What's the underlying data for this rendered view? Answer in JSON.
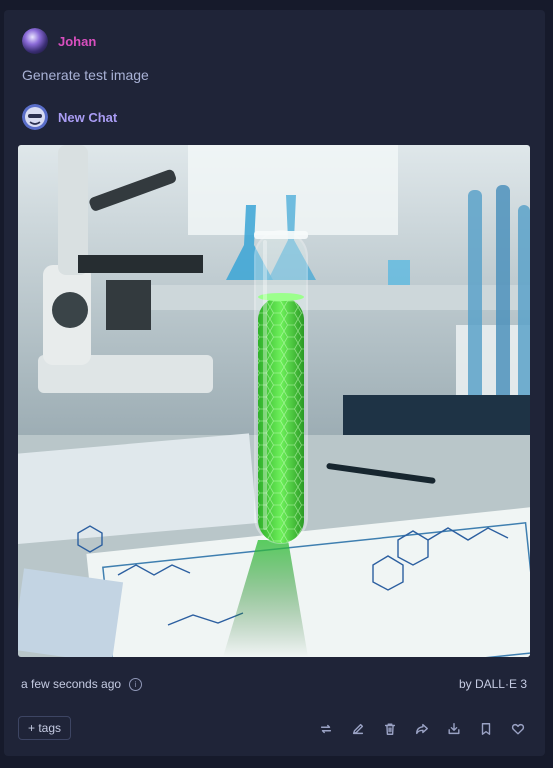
{
  "user": {
    "name": "Johan",
    "name_color": "#d94fbf"
  },
  "prompt": "Generate test image",
  "assistant": {
    "name": "New Chat",
    "name_color": "#a99cf3"
  },
  "image": {
    "subject": "green-test-tube-lab"
  },
  "footer": {
    "timestamp": "a few seconds ago",
    "model": "by DALL·E 3"
  },
  "actions": {
    "tags_label": "+ tags",
    "icons": [
      "repeat-icon",
      "edit-icon",
      "trash-icon",
      "share-icon",
      "download-icon",
      "bookmark-icon",
      "heart-icon"
    ]
  }
}
